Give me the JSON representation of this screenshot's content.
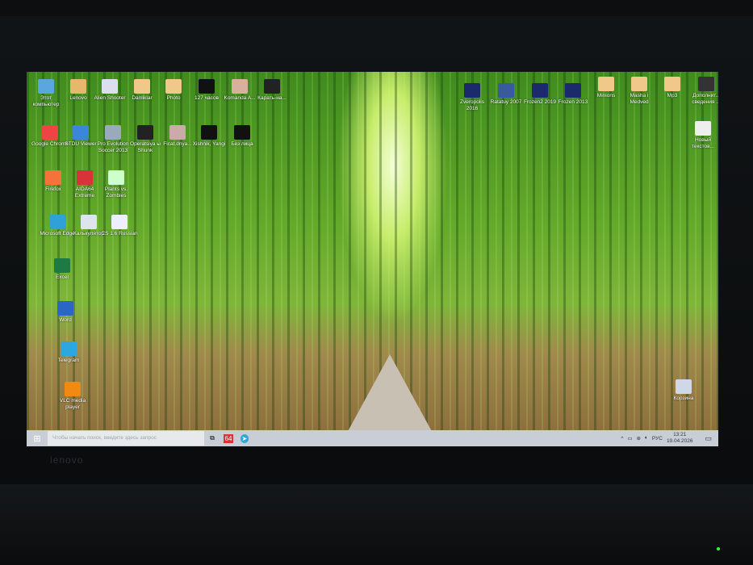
{
  "bezel": {
    "brand": "lenovo"
  },
  "desktop": {
    "icons_left": [
      {
        "label": "Этот компьютер",
        "color": "#5aa7e0"
      },
      {
        "label": "Lenovo",
        "color": "#e5b86b"
      },
      {
        "label": "Alien Shooter",
        "color": "#dde"
      },
      {
        "label": "Danliklar",
        "color": "#f0c98a"
      },
      {
        "label": "Photo",
        "color": "#f0c98a"
      },
      {
        "label": "127 часов",
        "color": "#111"
      },
      {
        "label": "Komanda A...",
        "color": "#d9b0a0"
      },
      {
        "label": "Карать-на...",
        "color": "#222"
      },
      {
        "label": "Google Chrome",
        "color": "#e44"
      },
      {
        "label": "STDU Viewer",
        "color": "#3a86d8"
      },
      {
        "label": "Pro Evolution Soccer 2013",
        "color": "#9ab"
      },
      {
        "label": "Operatsiya ы Shunk",
        "color": "#222"
      },
      {
        "label": "Ficat.dnya...",
        "color": "#caa"
      },
      {
        "label": "Xishnik, Yangi",
        "color": "#111"
      },
      {
        "label": "Без лица",
        "color": "#111"
      },
      {
        "label": "Firefox",
        "color": "#f5733a"
      },
      {
        "label": "AIDA64 Extreme",
        "color": "#d8323a"
      },
      {
        "label": "Plants vs. Zombies",
        "color": "#cfc"
      },
      {
        "label": "Microsoft Edge",
        "color": "#2fa0d8"
      },
      {
        "label": "Калькулятор",
        "color": "#dde4ec"
      },
      {
        "label": "CS 1.6 Russian",
        "color": "#eef"
      },
      {
        "label": "Excel",
        "color": "#1d7a44"
      },
      {
        "label": "Word",
        "color": "#2b66c4"
      },
      {
        "label": "Telegram",
        "color": "#2ea6de"
      },
      {
        "label": "VLC media player",
        "color": "#f08a12"
      }
    ],
    "icons_right": [
      {
        "label": "Zveropolis 2016",
        "color": "#1b2a6a"
      },
      {
        "label": "Ratatuy 2007",
        "color": "#3a5aa0"
      },
      {
        "label": "Frozen2 2019",
        "color": "#1b2a6a"
      },
      {
        "label": "Frozen 2013",
        "color": "#1b2a6a"
      },
      {
        "label": "Minions",
        "color": "#f0c98a"
      },
      {
        "label": "Masha i Medved",
        "color": "#f0c98a"
      },
      {
        "label": "Mp3",
        "color": "#f0c98a"
      },
      {
        "label": "Дополнит... сведения ...",
        "color": "#333"
      },
      {
        "label": "Новый текстов...",
        "color": "#eee"
      },
      {
        "label": "Корзина",
        "color": "#cfd8e6"
      }
    ]
  },
  "taskbar": {
    "start_icon": "windows-icon",
    "search_placeholder": "Чтобы начать поиск, введите здесь запрос",
    "task_view_icon": "⧉",
    "aida_label": "64",
    "telegram_icon": "➤",
    "tray_chevron": "^",
    "language": "РУС",
    "time": "13:21",
    "date": "19.04.2026",
    "notification_icon": "▭"
  }
}
